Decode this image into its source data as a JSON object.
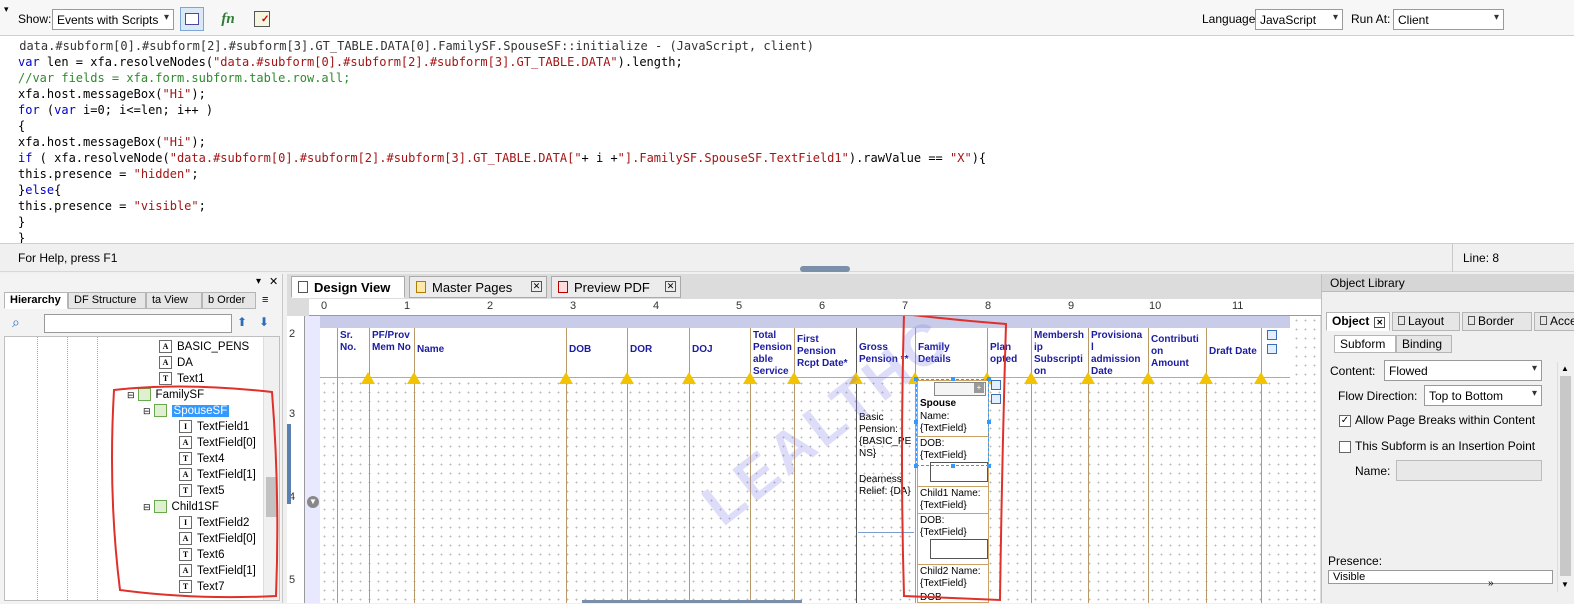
{
  "toolbar": {
    "show_label": "Show:",
    "show_value": "Events with Scripts",
    "fn_label": "fn",
    "language_label": "Language:",
    "language_value": "JavaScript",
    "run_at_label": "Run At:",
    "run_at_value": "Client"
  },
  "code": {
    "header": " data.#subform[0].#subform[2].#subform[3].GT_TABLE.DATA[0].FamilySF.SpouseSF::initialize - (JavaScript, client)",
    "l1a": "var",
    "l1b": " len = xfa.resolveNodes(",
    "l1c": "\"data.#subform[0].#subform[2].#subform[3].GT_TABLE.DATA\"",
    "l1d": ").length;",
    "l2": "//var fields = xfa.form.subform.table.row.all;",
    "l3a": "xfa.host.messageBox(",
    "l3b": "\"Hi\"",
    "l3c": ");",
    "l4a": "for",
    "l4b": " (",
    "l4c": "var",
    "l4d": " i=0; i<=len; i++ )",
    "l5": "{",
    "l6a": "xfa.host.messageBox(",
    "l6b": "\"Hi\"",
    "l6c": ");",
    "l7a": "if",
    "l7b": " ( xfa.resolveNode(",
    "l7c": "\"data.#subform[0].#subform[2].#subform[3].GT_TABLE.DATA[\"",
    "l7d": "+ i +",
    "l7e": "\"].FamilySF.SpouseSF.TextField1\"",
    "l7f": ").rawValue == ",
    "l7g": "\"X\"",
    "l7h": "){",
    "l8a": "this.presence = ",
    "l8b": "\"hidden\"",
    "l8c": ";",
    "l9a": "}",
    "l9b": "else",
    "l9c": "{",
    "l10a": "this.presence = ",
    "l10b": "\"visible\"",
    "l10c": ";",
    "l11": "}",
    "l12": "}"
  },
  "status": {
    "help": "For Help, press F1",
    "line": "Line: 8"
  },
  "hierarchy": {
    "tabs": [
      "Hierarchy",
      "PDF Structure",
      "Data View",
      "Tab Order"
    ],
    "tab_text": [
      "Hierarchy",
      "DF Structure",
      "ta View",
      "b Order"
    ],
    "items": [
      {
        "label": "BASIC_PENS",
        "icon": "T"
      },
      {
        "label": "DA",
        "icon": "T"
      },
      {
        "label": "Text1",
        "icon": "T"
      },
      {
        "label": "FamilySF",
        "icon": "S"
      },
      {
        "label": "SpouseSF",
        "icon": "S"
      },
      {
        "label": "TextField1",
        "icon": "I"
      },
      {
        "label": "TextField[0]",
        "icon": "T"
      },
      {
        "label": "Text4",
        "icon": "T"
      },
      {
        "label": "TextField[1]",
        "icon": "T"
      },
      {
        "label": "Text5",
        "icon": "T"
      },
      {
        "label": "Child1SF",
        "icon": "S"
      },
      {
        "label": "TextField2",
        "icon": "I"
      },
      {
        "label": "TextField[0]",
        "icon": "T"
      },
      {
        "label": "Text6",
        "icon": "T"
      },
      {
        "label": "TextField[1]",
        "icon": "T"
      },
      {
        "label": "Text7",
        "icon": "T"
      }
    ]
  },
  "design": {
    "tabs": [
      "Design View",
      "Master Pages",
      "Preview PDF"
    ],
    "ruler_h": [
      "0",
      "1",
      "2",
      "3",
      "4",
      "5",
      "6",
      "7",
      "8",
      "9",
      "10",
      "11"
    ],
    "ruler_v": [
      "2",
      "3",
      "4",
      "5"
    ],
    "columns": [
      "Sr. No.",
      "PF/Prov Mem No",
      "Name",
      "DOB",
      "DOR",
      "DOJ",
      "Total Pension able Service",
      "First Pension Rcpt Date*",
      "Gross Pension **",
      "Family Details",
      "Plan opted",
      "Membersh ip Subscripti on",
      "Provisiona l admission Date",
      "Contributi on Amount",
      "Draft Date"
    ],
    "cells": {
      "basic": "Basic Pension: {BASIC_PE NS}",
      "dearness": "Dearness Relief: {DA}",
      "spouse_title": "Spouse",
      "spouse_name": "Name: {TextField}",
      "spouse_dob": "DOB: {TextField}",
      "child1_name": "Child1 Name: {TextField}",
      "child1_dob": "DOB: {TextField}",
      "child2_name": "Child2 Name: {TextField}",
      "child2_dob": "DOB"
    },
    "watermark": "LEALTHC"
  },
  "object_panel": {
    "title": "Object Library",
    "tabs": [
      "Object",
      "Layout",
      "Border",
      "Accessibility"
    ],
    "subtabs": [
      "Subform",
      "Binding"
    ],
    "content_label": "Content:",
    "content_value": "Flowed",
    "flow_label": "Flow Direction:",
    "flow_value": "Top to Bottom",
    "allow_breaks": "Allow Page Breaks within Content",
    "insertion_point": "This Subform is an Insertion Point",
    "name_label": "Name:",
    "presence_label": "Presence:",
    "presence_value": "Visible"
  },
  "colors": {
    "annotation": "#e0302a",
    "header_text": "#1c1ca0",
    "selection": "#3399ff"
  }
}
